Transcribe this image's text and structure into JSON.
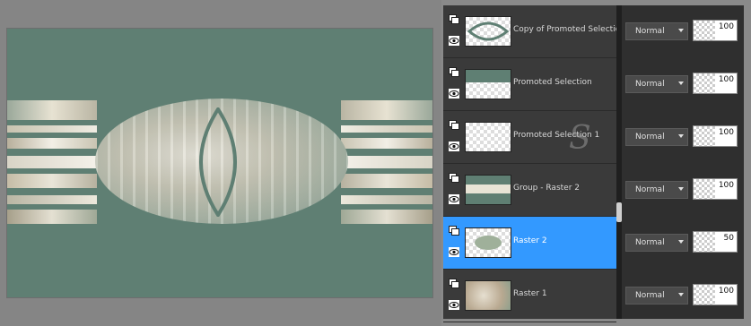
{
  "layers": [
    {
      "name": "Copy of Promoted Selection",
      "blend": "Normal",
      "opacity": "100",
      "selected": false
    },
    {
      "name": "Promoted Selection",
      "blend": "Normal",
      "opacity": "100",
      "selected": false
    },
    {
      "name": "Promoted Selection 1",
      "blend": "Normal",
      "opacity": "100",
      "selected": false
    },
    {
      "name": "Group - Raster 2",
      "blend": "Normal",
      "opacity": "100",
      "selected": false
    },
    {
      "name": "Raster 2",
      "blend": "Normal",
      "opacity": "50",
      "selected": true
    },
    {
      "name": "Raster 1",
      "blend": "Normal",
      "opacity": "100",
      "selected": false
    }
  ],
  "colors": {
    "canvas": "#5f7f73",
    "selection": "#3399ff"
  },
  "icons": {
    "visibility": "eye-icon",
    "layer_type": "layer-type-icon",
    "blend_dropdown": "chevron-down-icon"
  }
}
